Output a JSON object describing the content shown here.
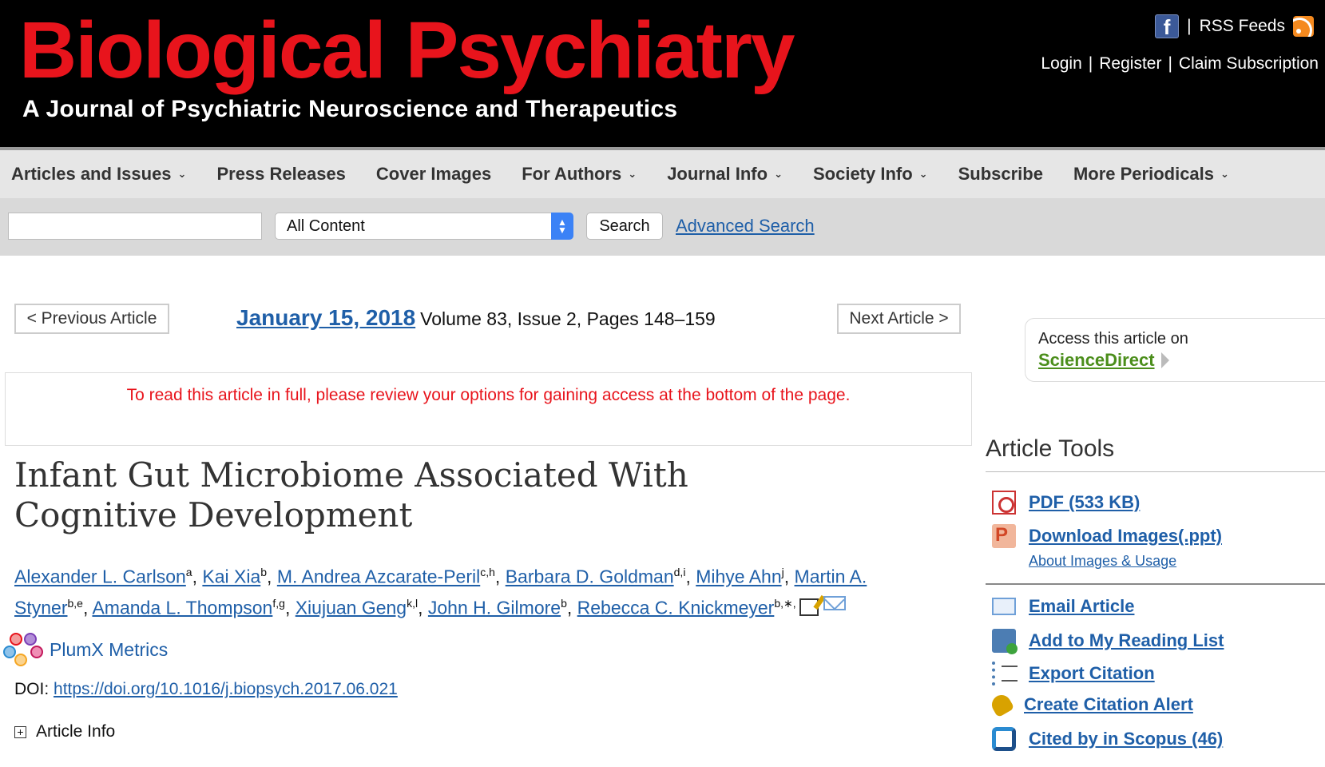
{
  "header": {
    "journal_title": "Biological Psychiatry",
    "journal_subtitle": "A Journal of Psychiatric Neuroscience and Therapeutics",
    "facebook_icon": "facebook-icon",
    "rss_label": "RSS Feeds",
    "rss_icon": "rss-icon",
    "separator": "|",
    "login": "Login",
    "register": "Register",
    "claim": "Claim Subscription"
  },
  "nav": {
    "items": [
      {
        "label": "Articles and Issues",
        "has_dropdown": true
      },
      {
        "label": "Press Releases",
        "has_dropdown": false
      },
      {
        "label": "Cover Images",
        "has_dropdown": false
      },
      {
        "label": "For Authors",
        "has_dropdown": true
      },
      {
        "label": "Journal Info",
        "has_dropdown": true
      },
      {
        "label": "Society Info",
        "has_dropdown": true
      },
      {
        "label": "Subscribe",
        "has_dropdown": false
      },
      {
        "label": "More Periodicals",
        "has_dropdown": true
      }
    ],
    "chevron": "⌄"
  },
  "search": {
    "input_value": "",
    "select_value": "All Content",
    "button_label": "Search",
    "advanced_label": "Advanced Search"
  },
  "article_nav": {
    "prev_label": "< Previous Article",
    "next_label": "Next Article >",
    "issue_date": "January 15, 2018",
    "issue_meta": "Volume 83, Issue 2, Pages 148–159"
  },
  "access_message": "To read this article in full, please review your options for gaining access at the bottom of the page.",
  "article": {
    "title_line1": "Infant Gut Microbiome Associated With",
    "title_line2": "Cognitive Development",
    "authors": [
      {
        "name": "Alexander L. Carlson",
        "sup": "a"
      },
      {
        "name": "Kai Xia",
        "sup": "b"
      },
      {
        "name": "M. Andrea Azcarate-Peril",
        "sup": "c,h"
      },
      {
        "name": "Barbara D. Goldman",
        "sup": "d,i"
      },
      {
        "name": "Mihye Ahn",
        "sup": "j"
      },
      {
        "name": "Martin A. Styner",
        "sup": "b,e"
      },
      {
        "name": "Amanda L. Thompson",
        "sup": "f,g"
      },
      {
        "name": "Xiujuan Geng",
        "sup": "k,l"
      },
      {
        "name": "John H. Gilmore",
        "sup": "b"
      },
      {
        "name": "Rebecca C. Knickmeyer",
        "sup": "b,∗,"
      }
    ],
    "author_separator": ", ",
    "plumx_label": "PlumX Metrics",
    "doi_prefix": "DOI: ",
    "doi_link": "https://doi.org/10.1016/j.biopsych.2017.06.021",
    "article_info_label": "Article Info",
    "expand_symbol": "+"
  },
  "sidebar": {
    "access_line1": "Access this article on",
    "access_link": "ScienceDirect",
    "tools_title": "Article Tools",
    "tools": [
      {
        "label": "PDF (533 KB)",
        "icon": "pdf-icon"
      },
      {
        "label": "Download Images(.ppt)",
        "icon": "ppt-icon"
      },
      {
        "label": "Email Article",
        "icon": "email-icon"
      },
      {
        "label": "Add to My Reading List",
        "icon": "reading-list-icon"
      },
      {
        "label": "Export Citation",
        "icon": "export-citation-icon"
      },
      {
        "label": "Create Citation Alert",
        "icon": "bell-icon"
      },
      {
        "label": "Cited by in Scopus (46)",
        "icon": "scopus-icon"
      }
    ],
    "about_images": "About Images & Usage"
  },
  "colors": {
    "brand_red": "#e8141c",
    "link_blue": "#1f5fa8",
    "sciencedirect_green": "#4b8e1b"
  }
}
